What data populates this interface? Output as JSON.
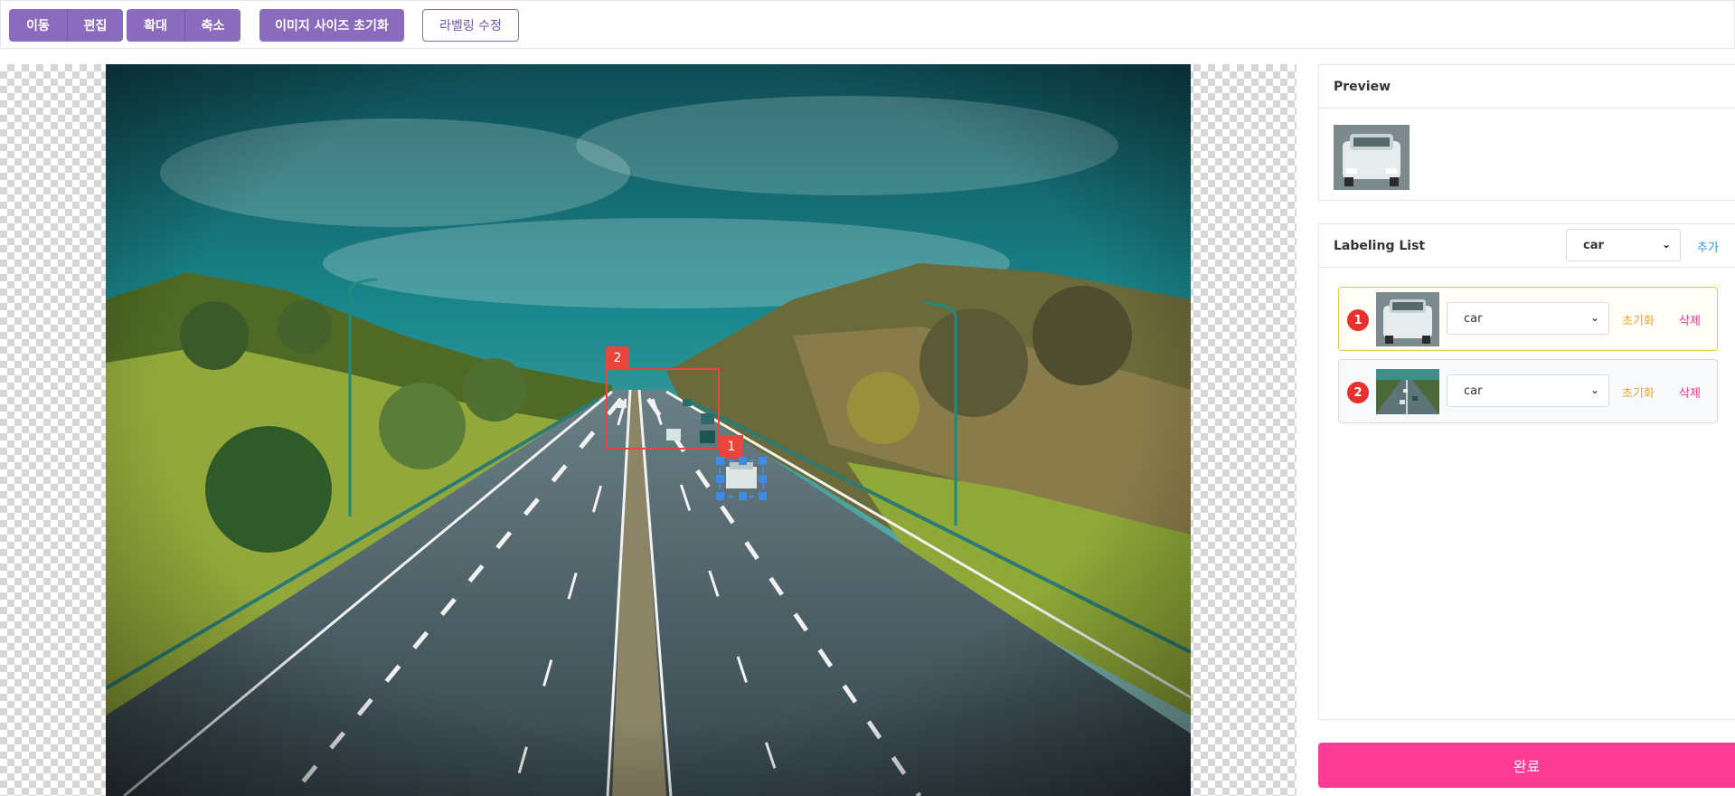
{
  "toolbar": {
    "move_label": "이동",
    "edit_label": "편집",
    "zoom_in_label": "확대",
    "zoom_out_label": "축소",
    "reset_size_label": "이미지 사이즈 초기화",
    "edit_labeling_label": "라벨링 수정"
  },
  "canvas": {
    "boxes": [
      {
        "tag": "1"
      },
      {
        "tag": "2"
      }
    ]
  },
  "preview": {
    "title": "Preview",
    "image": "car-crop"
  },
  "labeling": {
    "title": "Labeling List",
    "class_select": "car",
    "add_label": "추가",
    "items": [
      {
        "number": "1",
        "class": "car",
        "reset": "초기화",
        "delete": "삭제",
        "thumbnail": "car-crop"
      },
      {
        "number": "2",
        "class": "car",
        "reset": "초기화",
        "delete": "삭제",
        "thumbnail": "highway-crop"
      }
    ]
  },
  "done_label": "완료",
  "colors": {
    "toolbar_button": "#8b6bbd",
    "done_button": "#ff3c95",
    "box_red": "#e8463c",
    "box_selected": "#3d8de8",
    "reset_link": "#f0a22c",
    "delete_link": "#e83a8c",
    "add_link": "#2f9ae0"
  }
}
